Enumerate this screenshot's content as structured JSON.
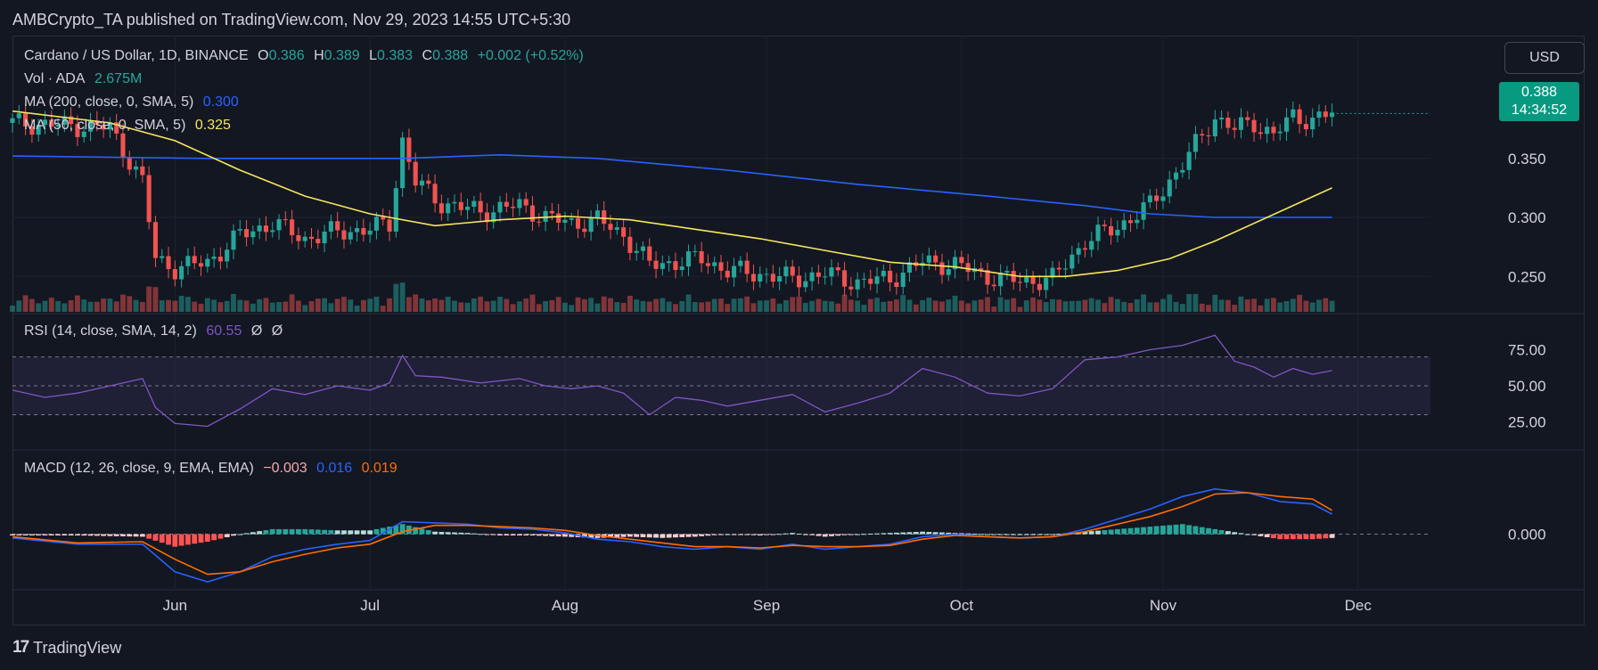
{
  "header": {
    "published_text": "AMBCrypto_TA published on TradingView.com, Nov 29, 2023 14:55 UTC+5:30"
  },
  "currency_button": "USD",
  "price_label": {
    "price": "0.388",
    "countdown": "14:34:52"
  },
  "footer": {
    "brand": "TradingView",
    "icon": "tradingview-logo-icon"
  },
  "colors": {
    "up": "#26a69a",
    "down": "#ef5350",
    "ma200": "#2962ff",
    "ma50": "#f6e65b",
    "rsi": "#7e57c2",
    "macd": "#2962ff",
    "signal": "#ff6d00"
  },
  "legends": {
    "main": {
      "symbol": "Cardano / US Dollar, 1D, BINANCE",
      "o_label": "O",
      "o": "0.386",
      "h_label": "H",
      "h": "0.389",
      "l_label": "L",
      "l": "0.383",
      "c_label": "C",
      "c": "0.388",
      "change": "+0.002 (+0.52%)"
    },
    "vol": {
      "label": "Vol · ADA",
      "value": "2.675M"
    },
    "ma200": {
      "label": "MA (200, close, 0, SMA, 5)",
      "value": "0.300"
    },
    "ma50": {
      "label": "MA (50, close, 0, SMA, 5)",
      "value": "0.325"
    },
    "rsi": {
      "label": "RSI (14, close, SMA, 14, 2)",
      "value": "60.55",
      "extra1": "Ø",
      "extra2": "Ø"
    },
    "macd": {
      "label": "MACD (12, 26, close, 9, EMA, EMA)",
      "macd": "−0.003",
      "signal": "0.016",
      "hist": "0.019"
    }
  },
  "chart_data": {
    "type": "candlestick",
    "symbol": "Cardano / US Dollar",
    "x_ticks": [
      "Jun",
      "Jul",
      "Aug",
      "Sep",
      "Oct",
      "Nov",
      "Dec"
    ],
    "price_axis": {
      "ticks": [
        "0.350",
        "0.300",
        "0.250"
      ],
      "range": [
        0.22,
        0.42
      ]
    },
    "rsi_axis": {
      "ticks": [
        "75.00",
        "50.00",
        "25.00"
      ],
      "range": [
        10,
        95
      ],
      "band": [
        30,
        70
      ]
    },
    "macd_axis": {
      "ticks": [
        "0.000"
      ],
      "range": [
        -0.05,
        0.06
      ]
    },
    "price_path": [
      [
        0,
        0.38
      ],
      [
        8,
        0.378
      ],
      [
        15,
        0.376
      ],
      [
        20,
        0.33
      ],
      [
        22,
        0.265
      ],
      [
        25,
        0.257
      ],
      [
        30,
        0.262
      ],
      [
        35,
        0.285
      ],
      [
        40,
        0.295
      ],
      [
        45,
        0.282
      ],
      [
        50,
        0.288
      ],
      [
        55,
        0.29
      ],
      [
        58,
        0.295
      ],
      [
        60,
        0.365
      ],
      [
        62,
        0.33
      ],
      [
        66,
        0.312
      ],
      [
        72,
        0.305
      ],
      [
        78,
        0.31
      ],
      [
        82,
        0.3
      ],
      [
        86,
        0.295
      ],
      [
        90,
        0.298
      ],
      [
        94,
        0.285
      ],
      [
        98,
        0.26
      ],
      [
        102,
        0.262
      ],
      [
        106,
        0.265
      ],
      [
        110,
        0.255
      ],
      [
        115,
        0.252
      ],
      [
        120,
        0.248
      ],
      [
        125,
        0.252
      ],
      [
        130,
        0.245
      ],
      [
        135,
        0.248
      ],
      [
        140,
        0.262
      ],
      [
        145,
        0.26
      ],
      [
        150,
        0.25
      ],
      [
        155,
        0.246
      ],
      [
        160,
        0.248
      ],
      [
        165,
        0.28
      ],
      [
        170,
        0.292
      ],
      [
        175,
        0.31
      ],
      [
        180,
        0.345
      ],
      [
        185,
        0.385
      ],
      [
        188,
        0.375
      ],
      [
        191,
        0.38
      ],
      [
        194,
        0.37
      ],
      [
        197,
        0.385
      ],
      [
        200,
        0.383
      ],
      [
        203,
        0.388
      ]
    ],
    "ma200_path": [
      [
        0,
        0.352
      ],
      [
        30,
        0.35
      ],
      [
        60,
        0.35
      ],
      [
        75,
        0.353
      ],
      [
        90,
        0.35
      ],
      [
        110,
        0.34
      ],
      [
        130,
        0.328
      ],
      [
        150,
        0.318
      ],
      [
        165,
        0.31
      ],
      [
        175,
        0.303
      ],
      [
        185,
        0.3
      ],
      [
        203,
        0.3
      ]
    ],
    "ma50_path": [
      [
        0,
        0.39
      ],
      [
        15,
        0.38
      ],
      [
        25,
        0.365
      ],
      [
        35,
        0.34
      ],
      [
        45,
        0.318
      ],
      [
        55,
        0.303
      ],
      [
        65,
        0.293
      ],
      [
        75,
        0.298
      ],
      [
        85,
        0.301
      ],
      [
        95,
        0.298
      ],
      [
        105,
        0.29
      ],
      [
        115,
        0.282
      ],
      [
        125,
        0.272
      ],
      [
        135,
        0.262
      ],
      [
        145,
        0.258
      ],
      [
        155,
        0.25
      ],
      [
        162,
        0.25
      ],
      [
        170,
        0.255
      ],
      [
        178,
        0.265
      ],
      [
        185,
        0.28
      ],
      [
        193,
        0.3
      ],
      [
        203,
        0.325
      ]
    ],
    "rsi_path": [
      [
        0,
        47
      ],
      [
        5,
        42
      ],
      [
        10,
        45
      ],
      [
        15,
        50
      ],
      [
        20,
        55
      ],
      [
        22,
        35
      ],
      [
        25,
        24
      ],
      [
        30,
        22
      ],
      [
        35,
        34
      ],
      [
        40,
        48
      ],
      [
        45,
        44
      ],
      [
        50,
        50
      ],
      [
        55,
        47
      ],
      [
        58,
        52
      ],
      [
        60,
        71
      ],
      [
        62,
        57
      ],
      [
        66,
        56
      ],
      [
        72,
        52
      ],
      [
        78,
        55
      ],
      [
        82,
        50
      ],
      [
        86,
        48
      ],
      [
        90,
        50
      ],
      [
        94,
        45
      ],
      [
        98,
        30
      ],
      [
        102,
        42
      ],
      [
        106,
        40
      ],
      [
        110,
        36
      ],
      [
        115,
        40
      ],
      [
        120,
        44
      ],
      [
        125,
        32
      ],
      [
        130,
        38
      ],
      [
        135,
        45
      ],
      [
        140,
        62
      ],
      [
        145,
        56
      ],
      [
        150,
        45
      ],
      [
        155,
        43
      ],
      [
        160,
        48
      ],
      [
        165,
        68
      ],
      [
        170,
        70
      ],
      [
        175,
        75
      ],
      [
        180,
        78
      ],
      [
        185,
        85
      ],
      [
        188,
        67
      ],
      [
        191,
        63
      ],
      [
        194,
        56
      ],
      [
        197,
        62
      ],
      [
        200,
        58
      ],
      [
        203,
        60.55
      ]
    ],
    "macd_path": [
      [
        0,
        -0.003
      ],
      [
        10,
        -0.008
      ],
      [
        20,
        -0.008
      ],
      [
        25,
        -0.03
      ],
      [
        30,
        -0.038
      ],
      [
        35,
        -0.03
      ],
      [
        40,
        -0.018
      ],
      [
        45,
        -0.012
      ],
      [
        50,
        -0.008
      ],
      [
        55,
        -0.005
      ],
      [
        60,
        0.01
      ],
      [
        65,
        0.009
      ],
      [
        70,
        0.008
      ],
      [
        75,
        0.005
      ],
      [
        80,
        0.004
      ],
      [
        85,
        0.001
      ],
      [
        90,
        -0.004
      ],
      [
        95,
        -0.006
      ],
      [
        100,
        -0.01
      ],
      [
        105,
        -0.012
      ],
      [
        110,
        -0.01
      ],
      [
        115,
        -0.012
      ],
      [
        120,
        -0.008
      ],
      [
        125,
        -0.012
      ],
      [
        130,
        -0.01
      ],
      [
        135,
        -0.008
      ],
      [
        140,
        -0.002
      ],
      [
        145,
        0.0
      ],
      [
        150,
        -0.002
      ],
      [
        155,
        -0.003
      ],
      [
        160,
        -0.002
      ],
      [
        165,
        0.004
      ],
      [
        170,
        0.012
      ],
      [
        175,
        0.02
      ],
      [
        180,
        0.03
      ],
      [
        185,
        0.036
      ],
      [
        190,
        0.033
      ],
      [
        195,
        0.026
      ],
      [
        200,
        0.024
      ],
      [
        203,
        0.016
      ]
    ],
    "signal_path": [
      [
        0,
        -0.002
      ],
      [
        10,
        -0.007
      ],
      [
        20,
        -0.006
      ],
      [
        25,
        -0.02
      ],
      [
        30,
        -0.032
      ],
      [
        35,
        -0.03
      ],
      [
        40,
        -0.022
      ],
      [
        45,
        -0.016
      ],
      [
        50,
        -0.011
      ],
      [
        55,
        -0.008
      ],
      [
        60,
        0.002
      ],
      [
        65,
        0.007
      ],
      [
        70,
        0.007
      ],
      [
        75,
        0.006
      ],
      [
        80,
        0.005
      ],
      [
        85,
        0.003
      ],
      [
        90,
        -0.001
      ],
      [
        95,
        -0.004
      ],
      [
        100,
        -0.007
      ],
      [
        105,
        -0.01
      ],
      [
        110,
        -0.01
      ],
      [
        115,
        -0.011
      ],
      [
        120,
        -0.009
      ],
      [
        125,
        -0.01
      ],
      [
        130,
        -0.01
      ],
      [
        135,
        -0.009
      ],
      [
        140,
        -0.004
      ],
      [
        145,
        -0.001
      ],
      [
        150,
        -0.002
      ],
      [
        155,
        -0.003
      ],
      [
        160,
        -0.002
      ],
      [
        165,
        0.002
      ],
      [
        170,
        0.008
      ],
      [
        175,
        0.014
      ],
      [
        180,
        0.022
      ],
      [
        185,
        0.032
      ],
      [
        190,
        0.033
      ],
      [
        195,
        0.03
      ],
      [
        200,
        0.028
      ],
      [
        203,
        0.019
      ]
    ],
    "x_tick_days": [
      25,
      55,
      85,
      116,
      146,
      177,
      207
    ],
    "x_max_day": 218
  }
}
